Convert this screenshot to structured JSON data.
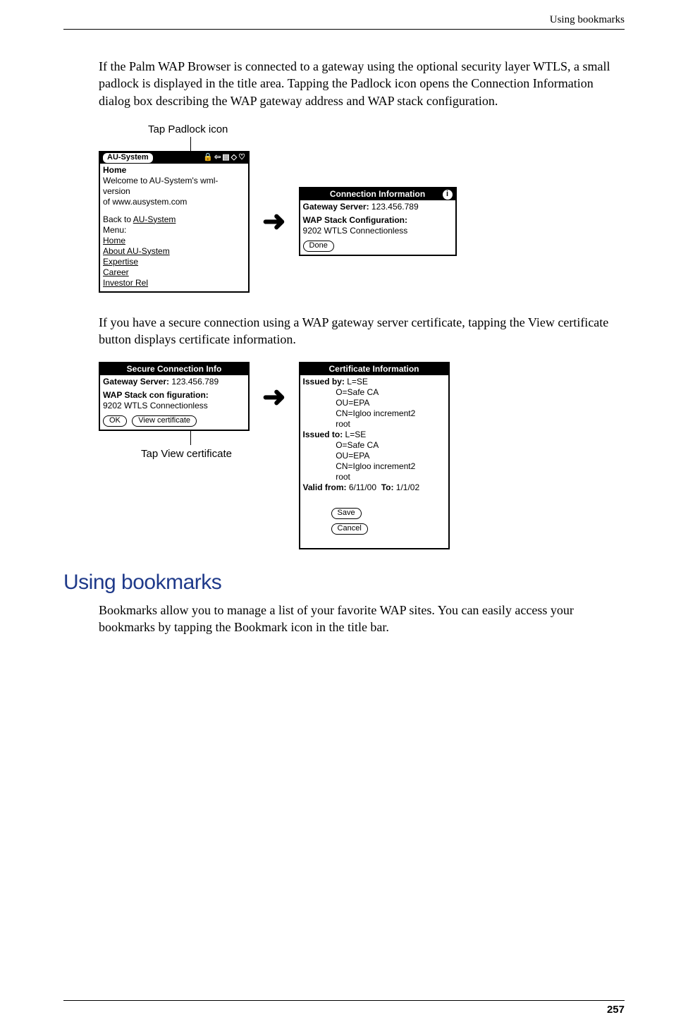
{
  "header": {
    "running": "Using bookmarks"
  },
  "para1": "If the Palm WAP Browser is connected to a gateway using the optional security layer WTLS, a small padlock is displayed in the title area. Tapping the Padlock icon opens the Connection Information dialog box describing the WAP gateway address and WAP stack configuration.",
  "fig1": {
    "caption": "Tap Padlock icon",
    "browser": {
      "titleLabel": "AU-System",
      "icon1": "🔒",
      "icon2": "⇦",
      "icon3": "▤",
      "icon4": "◇",
      "icon5": "♡",
      "home": "Home",
      "welcome1": "Welcome to AU-System's wml-version",
      "welcome2": "of www.ausystem.com",
      "back": "Back to ",
      "backLink": "AU-System",
      "menuLabel": "Menu:",
      "m1": "Home",
      "m2": "About AU-System",
      "m3": "Expertise",
      "m4": "Career",
      "m5": "Investor Rel"
    },
    "arrow": "➜",
    "dialog": {
      "title": "Connection Information",
      "info": "i",
      "gwLabel": "Gateway Server:",
      "gwValue": " 123.456.789",
      "stackLabel": "WAP Stack Configuration:",
      "stackValue": "9202 WTLS Connectionless",
      "done": "Done"
    }
  },
  "para2": "If you have a secure connection using a WAP gateway server certificate, tapping the View certificate button displays certificate information.",
  "fig2": {
    "secure": {
      "title": "Secure Connection Info",
      "gwLabel": "Gateway Server:",
      "gwValue": " 123.456.789",
      "stackLabel": "WAP Stack con figuration:",
      "stackValue": "9202 WTLS Connectionless",
      "ok": "OK",
      "view": "View certificate"
    },
    "arrow": "➜",
    "caption": "Tap View certificate",
    "cert": {
      "title": "Certificate Information",
      "issuedByLabel": "Issued by:",
      "ib1": " L=SE",
      "ib2": "              O=Safe CA",
      "ib3": "              OU=EPA",
      "ib4": "              CN=Igloo increment2",
      "ib5": "              root",
      "issuedToLabel": "Issued to:",
      "it1": " L=SE",
      "it2": "              O=Safe CA",
      "it3": "              OU=EPA",
      "it4": "              CN=Igloo increment2",
      "it5": "              root",
      "validFromLabel": "Valid from:",
      "validFrom": " 6/11/00  ",
      "toLabel": "To:",
      "toValue": " 1/1/02",
      "save": "Save",
      "cancel": "Cancel"
    }
  },
  "sectionHeading": "Using bookmarks",
  "para3": "Bookmarks allow you to manage a list of your favorite WAP sites. You can easily access your bookmarks by tapping the Bookmark icon in the title bar.",
  "pageNumber": "257"
}
